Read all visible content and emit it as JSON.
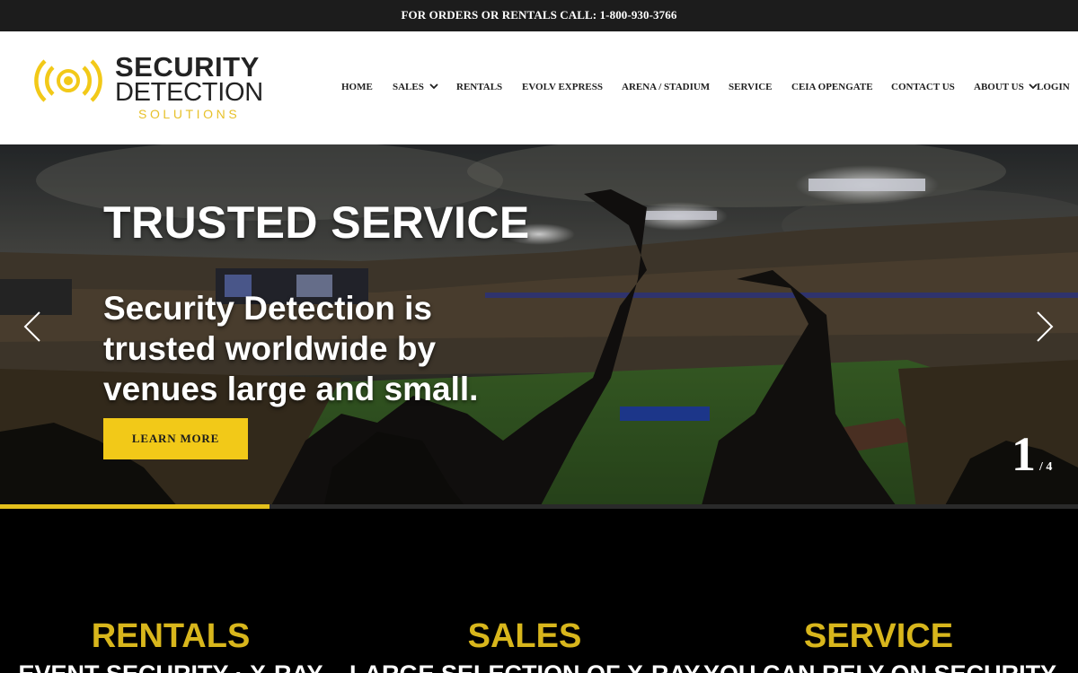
{
  "topbar": {
    "text": "FOR ORDERS OR RENTALS CALL: 1-800-930-3766"
  },
  "logo": {
    "line1": "SECURITY",
    "line2": "DETECTION",
    "line3": "SOLUTIONS"
  },
  "nav": {
    "items": [
      {
        "label": "HOME"
      },
      {
        "label": "SALES",
        "has_dropdown": true
      },
      {
        "label": "RENTALS"
      },
      {
        "label": "EVOLV EXPRESS"
      },
      {
        "label": "ARENA / STADIUM"
      },
      {
        "label": "SERVICE"
      },
      {
        "label": "CEIA OPENGATE"
      },
      {
        "label": "CONTACT US"
      },
      {
        "label": "ABOUT US",
        "has_dropdown": true
      }
    ],
    "login": "LOGIN"
  },
  "hero": {
    "title": "TRUSTED SERVICE",
    "subtitle": "Security Detection is trusted worldwide by venues large and small.",
    "button": "LEARN MORE",
    "slide_current": "1",
    "slide_total": "/ 4",
    "slide_progress": 0.25,
    "prev_icon": "chevron-left-icon",
    "next_icon": "chevron-right-icon"
  },
  "features": [
    {
      "title": "RENTALS",
      "text": "EVENT SECURITY · X-RAY"
    },
    {
      "title": "SALES",
      "text": "LARGE SELECTION OF X-RAY"
    },
    {
      "title": "SERVICE",
      "text": "YOU CAN RELY ON SECURITY"
    }
  ],
  "colors": {
    "accent": "#f2c918",
    "feature_title": "#d8b61c",
    "topbar_bg": "#1c1c1c",
    "header_bg": "#ffffff",
    "page_bg": "#000000"
  }
}
